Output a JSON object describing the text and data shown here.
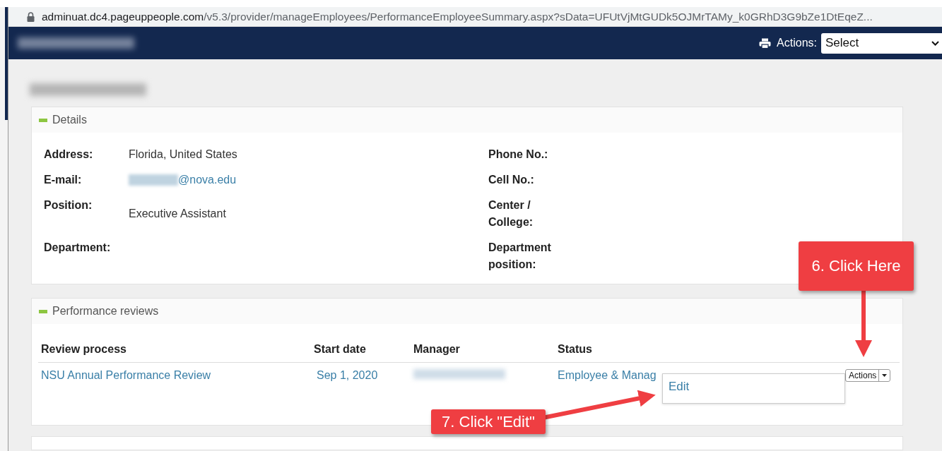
{
  "address_bar": {
    "host": "adminuat.dc4.pageuppeople.com",
    "path": "/v5.3/provider/manageEmployees/PerformanceEmployeeSummary.aspx?sData=UFUtVjMtGUDk5OJMrTAMy_k0GRhD3G9bZe1DtEqeZ..."
  },
  "header": {
    "actions_label": "Actions:",
    "actions_select": "Select"
  },
  "details": {
    "title": "Details",
    "expanded": true,
    "rows": [
      {
        "label": "Address:",
        "value": "Florida, United States",
        "kind": "text",
        "right_label": "Phone No.:"
      },
      {
        "label": "E-mail:",
        "value": "@nova.edu",
        "kind": "email",
        "right_label": "Cell No.:"
      },
      {
        "label": "Position:",
        "value": "Executive Assistant",
        "kind": "text",
        "right_label": "Center / College:"
      },
      {
        "label": "Department:",
        "kind": "empty",
        "right_label": "Department position:"
      }
    ]
  },
  "performance_reviews": {
    "title": "Performance reviews",
    "expanded": true,
    "columns": [
      "Review process",
      "Start date",
      "Manager",
      "Status"
    ],
    "rows": [
      {
        "review_process": "NSU Annual Performance Review",
        "start_date": "Sep 1, 2020",
        "status": "Employee & Manag",
        "actions": "Actions",
        "menu": [
          "Edit"
        ]
      }
    ]
  },
  "annotations": [
    {
      "text": "6. Click Here",
      "kind": "down"
    },
    {
      "text": "7. Click \"Edit\"",
      "kind": "right"
    }
  ]
}
